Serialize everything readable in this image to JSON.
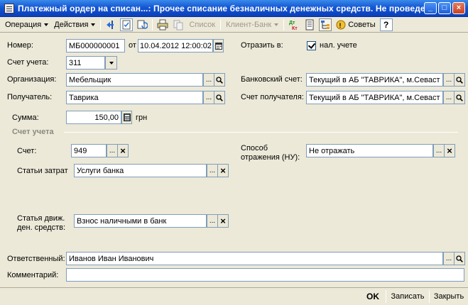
{
  "window": {
    "title": "Платежный ордер на списан...: Прочее списание безналичных денежных средств. Не проведен",
    "minimize": "_",
    "maximize": "□",
    "close": "×"
  },
  "toolbar": {
    "operation": "Операция",
    "actions": "Действия",
    "list": "Список",
    "client_bank": "Клиент-Банк",
    "dt_kt": "Дт Кт",
    "tips": "Советы",
    "help": "?"
  },
  "form": {
    "number_label": "Номер:",
    "number_value": "МБ000000001",
    "date_label": "от",
    "date_value": "10.04.2012 12:00:02",
    "reflect_label": "Отразить в:",
    "tax_label": "нал. учете",
    "tax_checked": true,
    "account_label": "Счет учета:",
    "account_value": "311",
    "org_label": "Организация:",
    "org_value": "Мебельщик",
    "bank_account_label": "Банковский счет:",
    "bank_account_value": "Текущий в АБ \"ТАВРИКА\", м.Севаст",
    "recipient_label": "Получатель:",
    "recipient_value": "Таврика",
    "recipient_account_label": "Счет получателя:",
    "recipient_account_value": "Текущий в АБ \"ТАВРИКА\", м.Севаст",
    "sum_label": "Сумма:",
    "sum_value": "150,00",
    "currency": "грн",
    "group_title": "Счет учета",
    "acc_label": "Счет:",
    "acc_value": "949",
    "method_label_1": "Способ",
    "method_label_2": "отражения (НУ):",
    "method_value": "Не отражать",
    "cost_label": "Статьи затрат",
    "cost_value": "Услуги банка",
    "cash_label_1": "Статья движ.",
    "cash_label_2": "ден. средств:",
    "cash_value": "Взнос наличными в банк",
    "responsible_label": "Ответственный:",
    "responsible_value": "Иванов Иван Иванович",
    "comment_label": "Комментарий:",
    "comment_value": ""
  },
  "buttons": {
    "ok": "OK",
    "save": "Записать",
    "close": "Закрыть",
    "ellipsis": "...",
    "clear": "×"
  }
}
